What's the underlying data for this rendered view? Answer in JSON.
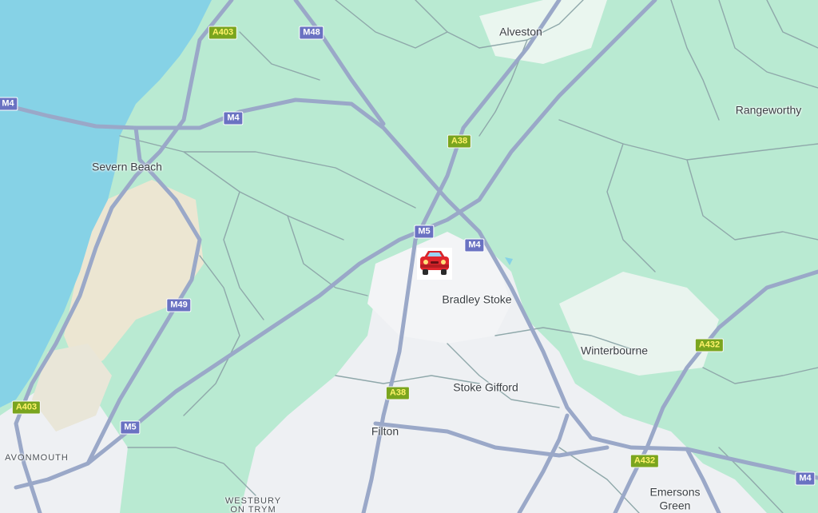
{
  "colors": {
    "water": "#86d2e6",
    "land_green": "#b9ead2",
    "urban": "#eef0f3",
    "sand": "#ece6d2",
    "motorway": "#9aa8c8",
    "minor_road": "#8fa8aa"
  },
  "places": [
    {
      "id": "alveston",
      "label": "Alveston"
    },
    {
      "id": "rangeworthy",
      "label": "Rangeworthy"
    },
    {
      "id": "severn-beach",
      "label": "Severn Beach"
    },
    {
      "id": "bradley-stoke",
      "label": "Bradley Stoke"
    },
    {
      "id": "winterbourne",
      "label": "Winterbourne"
    },
    {
      "id": "stoke-gifford",
      "label": "Stoke Gifford"
    },
    {
      "id": "filton",
      "label": "Filton"
    },
    {
      "id": "emersons-green-1",
      "label": "Emersons"
    },
    {
      "id": "emersons-green-2",
      "label": "Green"
    },
    {
      "id": "avonmouth",
      "label": "AVONMOUTH"
    },
    {
      "id": "westbury-1",
      "label": "WESTBURY"
    },
    {
      "id": "westbury-2",
      "label": "ON TRYM"
    }
  ],
  "road_shields": [
    {
      "id": "a403-top",
      "label": "A403",
      "kind": "a-road"
    },
    {
      "id": "m48",
      "label": "M48",
      "kind": "motorway"
    },
    {
      "id": "m4-left",
      "label": "M4",
      "kind": "motorway"
    },
    {
      "id": "m4-mid",
      "label": "M4",
      "kind": "motorway"
    },
    {
      "id": "a38-top",
      "label": "A38",
      "kind": "a-road"
    },
    {
      "id": "m5-center",
      "label": "M5",
      "kind": "motorway"
    },
    {
      "id": "m4-center",
      "label": "M4",
      "kind": "motorway"
    },
    {
      "id": "m49",
      "label": "M49",
      "kind": "motorway"
    },
    {
      "id": "a432-right",
      "label": "A432",
      "kind": "a-road"
    },
    {
      "id": "a38-bottom",
      "label": "A38",
      "kind": "a-road"
    },
    {
      "id": "a403-bottom",
      "label": "A403",
      "kind": "a-road"
    },
    {
      "id": "m5-bottom",
      "label": "M5",
      "kind": "motorway"
    },
    {
      "id": "a432-bottom",
      "label": "A432",
      "kind": "a-road"
    },
    {
      "id": "m4-right",
      "label": "M4",
      "kind": "motorway"
    }
  ],
  "marker": {
    "icon": "car-icon",
    "glyph": "🚗"
  }
}
